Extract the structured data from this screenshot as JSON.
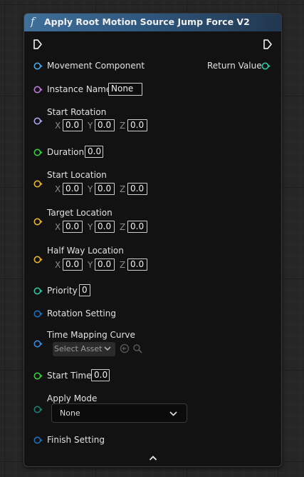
{
  "node": {
    "title": "Apply Root Motion Source Jump Force V2",
    "function_glyph": "f"
  },
  "colors": {
    "header_blue": "#3f6f9a",
    "pin_blue": "#4aa8e8",
    "pin_purple": "#c07ad8",
    "pin_lavender": "#a9a6f0",
    "pin_green": "#3ccf3c",
    "pin_yellow": "#e8b530",
    "pin_teal": "#2fc7a3",
    "pin_dark_teal": "#1f7f78"
  },
  "pins": {
    "movement_component": "Movement Component",
    "return_value": "Return Value",
    "instance_name": {
      "label": "Instance Name",
      "value": "None"
    },
    "start_rotation": {
      "label": "Start Rotation",
      "x": "0.0",
      "y": "0.0",
      "z": "0.0"
    },
    "duration": {
      "label": "Duration",
      "value": "0.0"
    },
    "start_location": {
      "label": "Start Location",
      "x": "0.0",
      "y": "0.0",
      "z": "0.0"
    },
    "target_location": {
      "label": "Target Location",
      "x": "0.0",
      "y": "0.0",
      "z": "0.0"
    },
    "half_way_location": {
      "label": "Half Way Location",
      "x": "0.0",
      "y": "0.0",
      "z": "0.0"
    },
    "priority": {
      "label": "Priority",
      "value": "0"
    },
    "rotation_setting": "Rotation Setting",
    "time_mapping_curve": {
      "label": "Time Mapping Curve",
      "placeholder": "Select Asset"
    },
    "start_time": {
      "label": "Start Time",
      "value": "0.0"
    },
    "apply_mode": {
      "label": "Apply Mode",
      "value": "None"
    },
    "finish_setting": "Finish Setting"
  },
  "axis_labels": {
    "x": "X",
    "y": "Y",
    "z": "Z"
  },
  "icons": [
    "function-icon",
    "exec-in-icon",
    "exec-out-icon",
    "chevron-down-icon",
    "use-selected-asset-icon",
    "browse-search-icon",
    "collapse-chevron-up-icon"
  ]
}
